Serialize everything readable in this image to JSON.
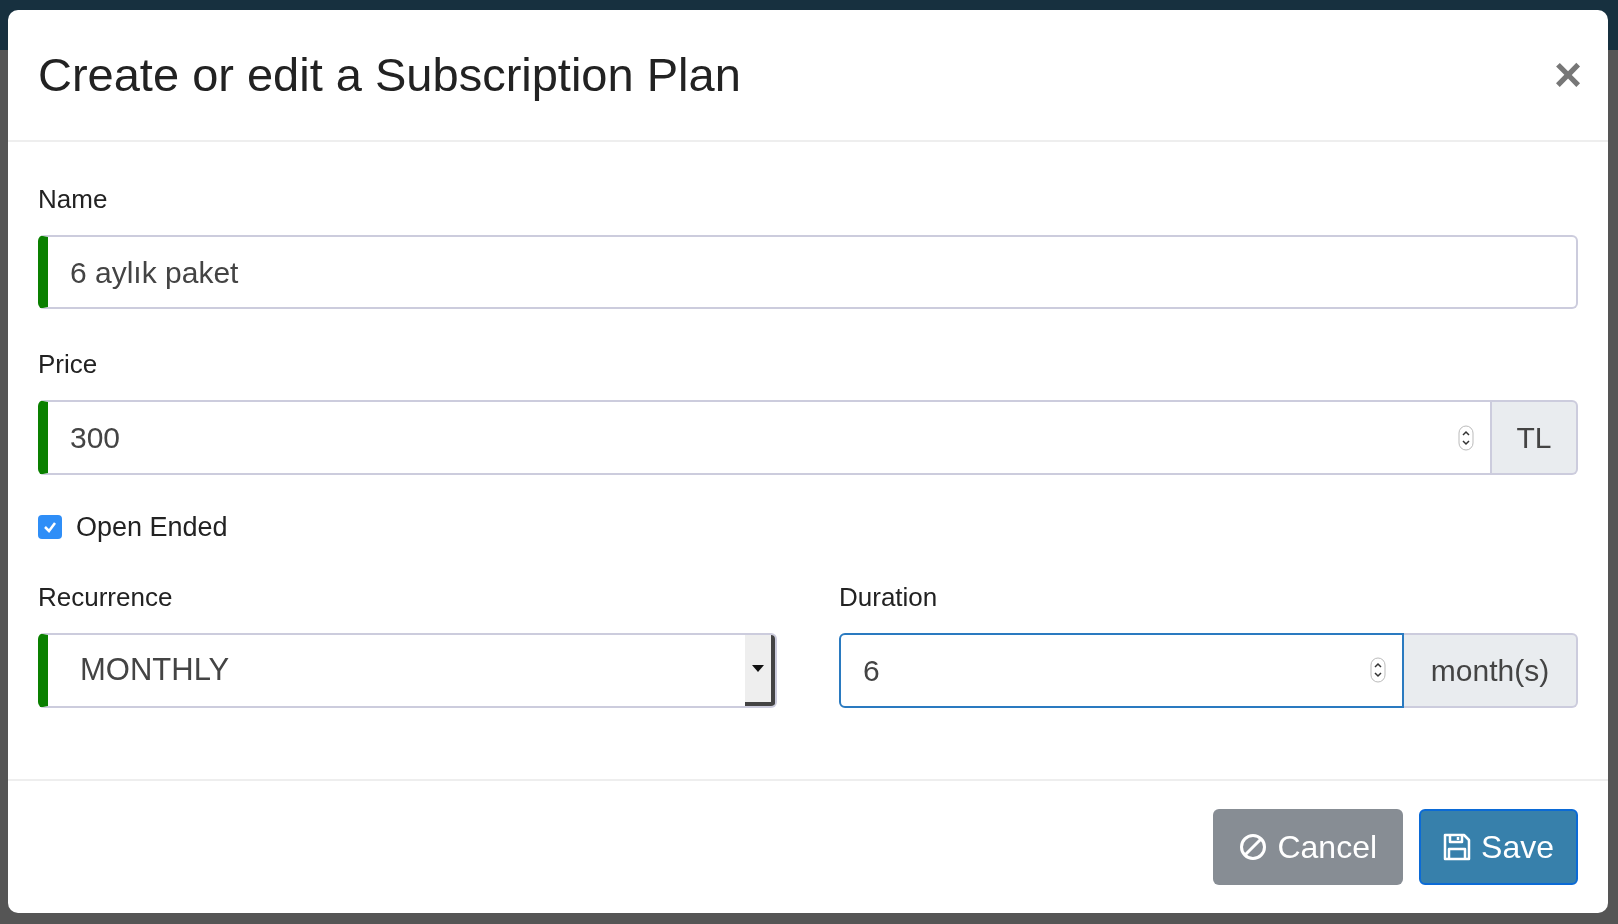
{
  "dialog": {
    "title": "Create or edit a Subscription Plan",
    "close": "×"
  },
  "fields": {
    "name": {
      "label": "Name",
      "value": "6 aylık paket",
      "valid": true
    },
    "price": {
      "label": "Price",
      "value": "300",
      "addon": "TL",
      "valid": true
    },
    "open_ended": {
      "label": "Open Ended",
      "checked": true
    },
    "recurrence": {
      "label": "Recurrence",
      "value": "MONTHLY",
      "valid": true
    },
    "duration": {
      "label": "Duration",
      "value": "6",
      "addon": "month(s)",
      "focused": true
    }
  },
  "buttons": [
    {
      "kind": "cancel",
      "label": "Cancel"
    },
    {
      "kind": "save",
      "label": "Save"
    }
  ]
}
